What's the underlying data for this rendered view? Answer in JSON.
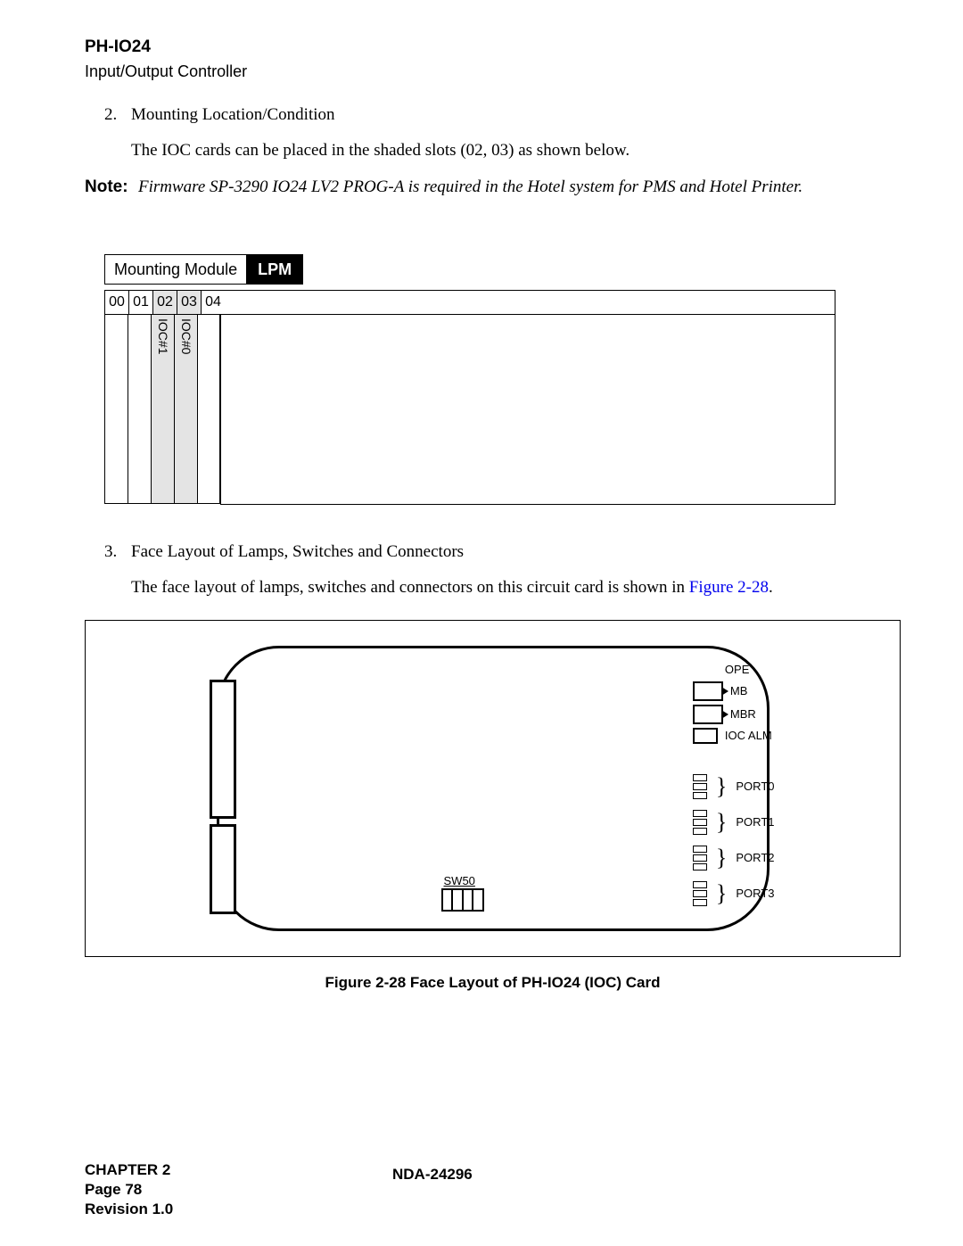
{
  "header": {
    "code": "PH-IO24",
    "subtitle": "Input/Output Controller"
  },
  "section2": {
    "num": "2.",
    "title": "Mounting Location/Condition",
    "body": "The IOC cards can be placed in the shaded slots (02, 03) as shown below."
  },
  "note": {
    "label": "Note:",
    "text": "Firmware SP-3290 IO24 LV2 PROG-A is required in the Hotel system for PMS and Hotel Printer."
  },
  "mounting": {
    "module_label": "Mounting Module",
    "lpm": "LPM",
    "slots": [
      "00",
      "01",
      "02",
      "03",
      "04"
    ],
    "ioc1": "IOC#1",
    "ioc0": "IOC#0"
  },
  "section3": {
    "num": "3.",
    "title": "Face Layout of Lamps, Switches and Connectors",
    "body_a": "The face layout of lamps, switches and connectors on this circuit card is shown in",
    "fig_ref": "Figure 2-28",
    "body_b": "."
  },
  "face": {
    "sw50": "SW50",
    "labels": {
      "ope": "OPE",
      "mb": "MB",
      "mbr": "MBR",
      "iocalm": "IOC ALM"
    },
    "ports": [
      "PORT0",
      "PORT1",
      "PORT2",
      "PORT3"
    ]
  },
  "figure_caption": "Figure 2-28   Face Layout of PH-IO24 (IOC) Card",
  "footer": {
    "chapter": "CHAPTER 2",
    "page": "Page 78",
    "rev": "Revision 1.0",
    "doc": "NDA-24296"
  }
}
